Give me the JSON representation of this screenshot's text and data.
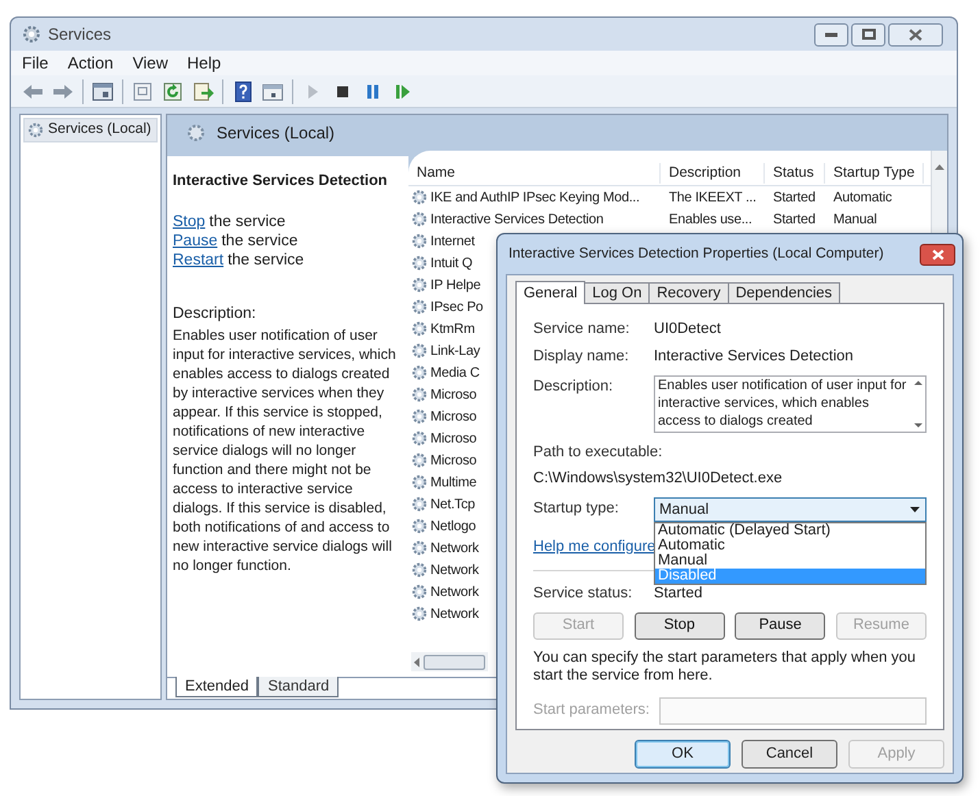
{
  "window": {
    "title": "Services"
  },
  "menu": [
    "File",
    "Action",
    "View",
    "Help"
  ],
  "toolbar": [
    {
      "kind": "back"
    },
    {
      "kind": "forward"
    },
    {
      "kind": "separator"
    },
    {
      "kind": "tree"
    },
    {
      "kind": "separator"
    },
    {
      "kind": "properties"
    },
    {
      "kind": "refresh"
    },
    {
      "kind": "export"
    },
    {
      "kind": "separator"
    },
    {
      "kind": "help"
    },
    {
      "kind": "view"
    },
    {
      "kind": "separator"
    },
    {
      "kind": "start"
    },
    {
      "kind": "stop"
    },
    {
      "kind": "pause"
    },
    {
      "kind": "resume"
    }
  ],
  "tree": [
    {
      "label": "Services (Local)",
      "selected": true
    }
  ],
  "header": {
    "title": "Services (Local)"
  },
  "details": {
    "title": "Interactive Services Detection",
    "actions": [
      {
        "link": "Stop",
        "text": "the service"
      },
      {
        "link": "Pause",
        "text": "the service"
      },
      {
        "link": "Restart",
        "text": "the service"
      }
    ],
    "description_label": "Description:",
    "description": "Enables user notification of user input for interactive services, which enables access to dialogs created by interactive services when they appear. If this service is stopped, notifications of new interactive service dialogs will no longer function and there might not be access to interactive service dialogs. If this service is disabled, both notifications of and access to new interactive service dialogs will no longer function."
  },
  "table": {
    "columns": [
      "Name",
      "Description",
      "Status",
      "Startup Type"
    ],
    "rows": [
      {
        "name": "IKE and AuthIP IPsec Keying Mod...",
        "description": "The IKEEXT ...",
        "status": "Started",
        "startup_type": "Automatic"
      },
      {
        "name": "Interactive Services Detection",
        "description": "Enables use...",
        "status": "Started",
        "startup_type": "Manual"
      },
      {
        "name": "Internet"
      },
      {
        "name": "Intuit Q"
      },
      {
        "name": "IP Helpe"
      },
      {
        "name": "IPsec Po"
      },
      {
        "name": "KtmRm"
      },
      {
        "name": "Link-Lay"
      },
      {
        "name": "Media C"
      },
      {
        "name": "Microso"
      },
      {
        "name": "Microso"
      },
      {
        "name": "Microso"
      },
      {
        "name": "Microso"
      },
      {
        "name": "Multime"
      },
      {
        "name": "Net.Tcp"
      },
      {
        "name": "Netlogo"
      },
      {
        "name": "Network"
      },
      {
        "name": "Network"
      },
      {
        "name": "Network"
      },
      {
        "name": "Network"
      }
    ]
  },
  "view_tabs": [
    {
      "label": "Extended",
      "selected": true
    },
    {
      "label": "Standard",
      "selected": false
    }
  ],
  "dialog": {
    "title": "Interactive Services Detection Properties (Local Computer)",
    "tabs": [
      {
        "label": "General",
        "selected": true
      },
      {
        "label": "Log On",
        "selected": false
      },
      {
        "label": "Recovery",
        "selected": false
      },
      {
        "label": "Dependencies",
        "selected": false
      }
    ],
    "service_name_label": "Service name:",
    "service_name": "UI0Detect",
    "display_name_label": "Display name:",
    "display_name": "Interactive Services Detection",
    "description_label": "Description:",
    "description": "Enables user notification of user input for interactive services, which enables access to dialogs created",
    "path_label": "Path to executable:",
    "path": "C:\\Windows\\system32\\UI0Detect.exe",
    "startup_label": "Startup type:",
    "startup_value": "Manual",
    "startup_options": [
      {
        "label": "Automatic (Delayed Start)",
        "selected": false
      },
      {
        "label": "Automatic",
        "selected": false
      },
      {
        "label": "Manual",
        "selected": false
      },
      {
        "label": "Disabled",
        "selected": true
      }
    ],
    "help_link": "Help me configure",
    "status_label": "Service status:",
    "status": "Started",
    "service_buttons": [
      {
        "label": "Start",
        "disabled": true
      },
      {
        "label": "Stop",
        "disabled": false
      },
      {
        "label": "Pause",
        "disabled": false
      },
      {
        "label": "Resume",
        "disabled": true
      }
    ],
    "hint": "You can specify the start parameters that apply when you start the service from here.",
    "params_label": "Start parameters:",
    "params_disabled": true,
    "footer_buttons": [
      {
        "label": "OK",
        "disabled": false,
        "default": true
      },
      {
        "label": "Cancel",
        "disabled": false,
        "default": false
      },
      {
        "label": "Apply",
        "disabled": true,
        "default": false
      }
    ]
  }
}
